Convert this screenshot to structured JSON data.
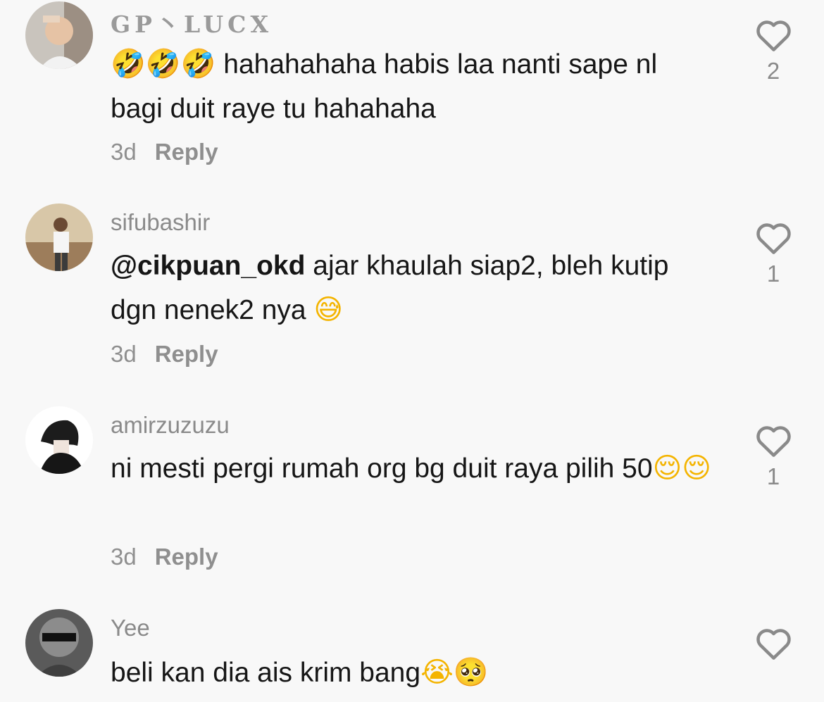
{
  "comments": [
    {
      "username": "GP丶LUCX",
      "text_parts": [
        "🤣🤣🤣",
        " hahahahaha habis laa nanti sape nl bagi duit raye tu hahahaha"
      ],
      "time": "3d",
      "reply_label": "Reply",
      "likes": "2"
    },
    {
      "username": "sifubashir",
      "mention": "@cikpuan_okd",
      "text": " ajar khaulah siap2, bleh kutip dgn nenek2 nya ",
      "emoji": "😅",
      "time": "3d",
      "reply_label": "Reply",
      "likes": "1"
    },
    {
      "username": "amirzuzuzu",
      "text": "ni mesti pergi rumah org bg duit raya pilih 50",
      "emoji": "😌😌",
      "time": "3d",
      "reply_label": "Reply",
      "likes": "1"
    },
    {
      "username": "Yee",
      "text": "beli kan dia ais krim bang",
      "emoji": "😭🥺"
    }
  ],
  "icons": {
    "like": "heart-outline-icon"
  },
  "colors": {
    "background": "#f8f8f8",
    "secondary_text": "#8a8a8a",
    "primary_text": "#161616"
  }
}
